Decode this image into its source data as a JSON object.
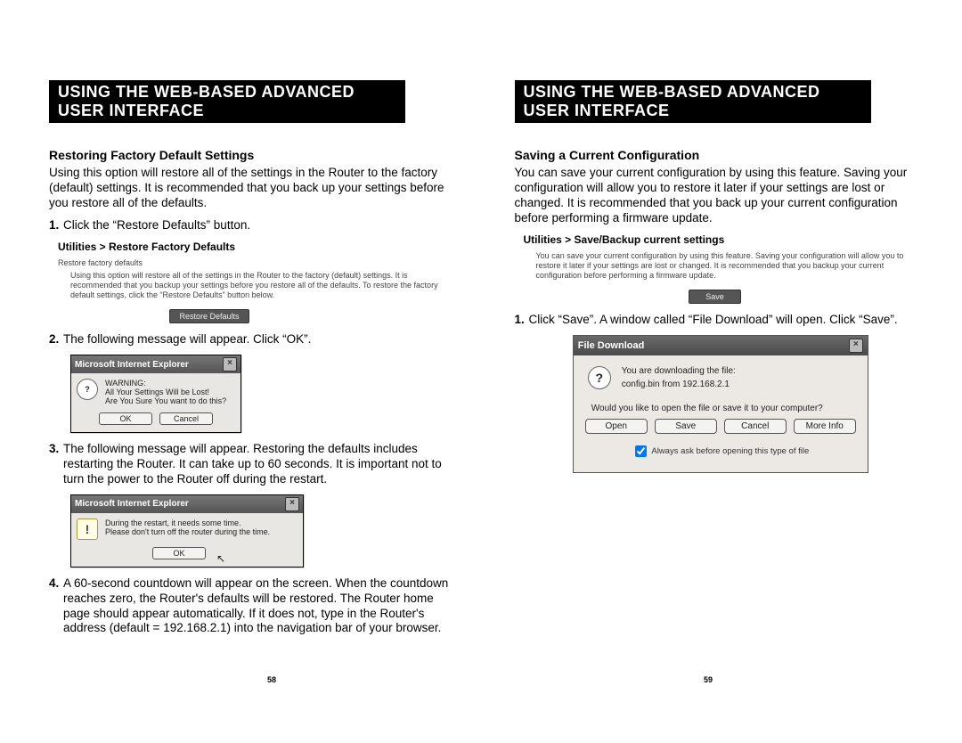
{
  "left": {
    "banner": "USING THE WEB-BASED ADVANCED USER INTERFACE",
    "section_title": "Restoring Factory Default Settings",
    "intro": "Using this option will restore all of the settings in the Router to the factory (default) settings. It is recommended that you back up your settings before you restore all of the defaults.",
    "steps": {
      "s1": "Click the “Restore Defaults” button.",
      "s2": "The following message will appear. Click “OK”.",
      "s3": "The following message will appear. Restoring the defaults includes restarting the Router. It can take up to 60 seconds. It is important not to turn the power to the Router off during the restart.",
      "s4": "A 60-second countdown will appear on the screen. When the countdown reaches zero, the Router's defaults will be restored. The Router home page should appear automatically. If it does not, type in the Router's address (default = 192.168.2.1) into the navigation bar of your browser."
    },
    "router_panel": {
      "title": "Utilities > Restore Factory Defaults",
      "sub": "Restore factory defaults",
      "desc": "Using this option will restore all of the settings in the Router to the factory (default) settings. It is recommended that you backup your settings before you restore all of the defaults. To restore the factory default settings, click the “Restore Defaults” button below.",
      "button": "Restore Defaults"
    },
    "dialog1": {
      "title": "Microsoft Internet Explorer",
      "line1": "WARNING:",
      "line2": "All Your Settings Will be Lost!",
      "line3": "Are You Sure You want to do this?",
      "ok": "OK",
      "cancel": "Cancel"
    },
    "dialog2": {
      "title": "Microsoft Internet Explorer",
      "line1": "During the restart, it needs some time.",
      "line2": "Please don't turn off the router during the time.",
      "ok": "OK"
    },
    "page_num": "58"
  },
  "right": {
    "banner": "USING THE WEB-BASED ADVANCED USER INTERFACE",
    "section_title": "Saving a Current Configuration",
    "intro": "You can save your current configuration by using this feature. Saving your configuration will allow you to restore it later if your settings are lost or changed. It is recommended that you back up your current configuration before performing a firmware update.",
    "router_panel": {
      "title": "Utilities > Save/Backup current settings",
      "desc": "You can save your current configuration by using this feature. Saving your configuration will allow you to restore it later if your settings are lost or changed. It is recommended that you backup your current configuration before performing a firmware update.",
      "button": "Save"
    },
    "step1": "Click “Save”. A window called “File Download” will open. Click “Save”.",
    "dl_dialog": {
      "title": "File Download",
      "line1": "You are downloading the file:",
      "line2": "config.bin from 192.168.2.1",
      "prompt": "Would you like to open the file or save it to your computer?",
      "open": "Open",
      "save": "Save",
      "cancel": "Cancel",
      "more": "More Info",
      "always": "Always ask before opening this type of file"
    },
    "page_num": "59"
  }
}
